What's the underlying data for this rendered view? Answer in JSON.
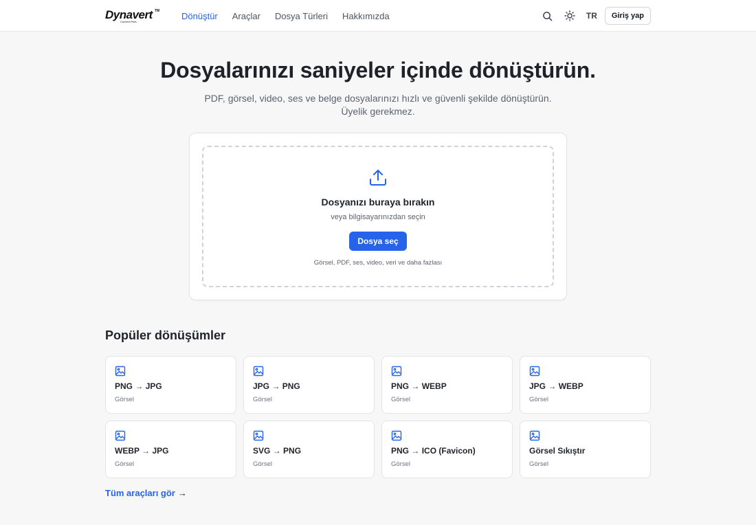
{
  "header": {
    "logo_text": "Dynavert",
    "logo_tagline": "Convert Files",
    "nav": [
      {
        "label": "Dönüştür",
        "active": true
      },
      {
        "label": "Araçlar",
        "active": false
      },
      {
        "label": "Dosya Türleri",
        "active": false
      },
      {
        "label": "Hakkımızda",
        "active": false
      }
    ],
    "lang": "TR",
    "login_label": "Giriş yap"
  },
  "hero": {
    "title": "Dosyalarınızı saniyeler içinde dönüştürün.",
    "subtitle_line1": "PDF, görsel, video, ses ve belge dosyalarınızı hızlı ve güvenli şekilde dönüştürün.",
    "subtitle_line2": "Üyelik gerekmez."
  },
  "upload": {
    "title": "Dosyanızı buraya bırakın",
    "subtitle": "veya bilgisayarınızdan seçin",
    "button_label": "Dosya seç",
    "hint": "Görsel, PDF, ses, video, veri ve daha fazlası"
  },
  "popular": {
    "heading": "Popüler dönüşümler",
    "items": [
      {
        "from": "PNG",
        "arrow": "→",
        "to": "JPG",
        "category": "Görsel"
      },
      {
        "from": "JPG",
        "arrow": "→",
        "to": "PNG",
        "category": "Görsel"
      },
      {
        "from": "PNG",
        "arrow": "→",
        "to": "WEBP",
        "category": "Görsel"
      },
      {
        "from": "JPG",
        "arrow": "→",
        "to": "WEBP",
        "category": "Görsel"
      },
      {
        "from": "WEBP",
        "arrow": "→",
        "to": "JPG",
        "category": "Görsel"
      },
      {
        "from": "SVG",
        "arrow": "→",
        "to": "PNG",
        "category": "Görsel"
      },
      {
        "from": "PNG",
        "arrow": "→",
        "to": "ICO (Favicon)",
        "category": "Görsel"
      },
      {
        "from": "Görsel Sıkıştır",
        "arrow": "",
        "to": "",
        "category": "Görsel"
      }
    ],
    "all_tools_label": "Tüm araçları gör",
    "all_tools_arrow": "→"
  },
  "colors": {
    "accent": "#2563eb",
    "background": "#f7f7f8",
    "text": "#1f2329"
  },
  "icons": {
    "search": "search-icon",
    "theme": "sun-icon",
    "upload": "upload-icon",
    "card": "image-icon"
  }
}
